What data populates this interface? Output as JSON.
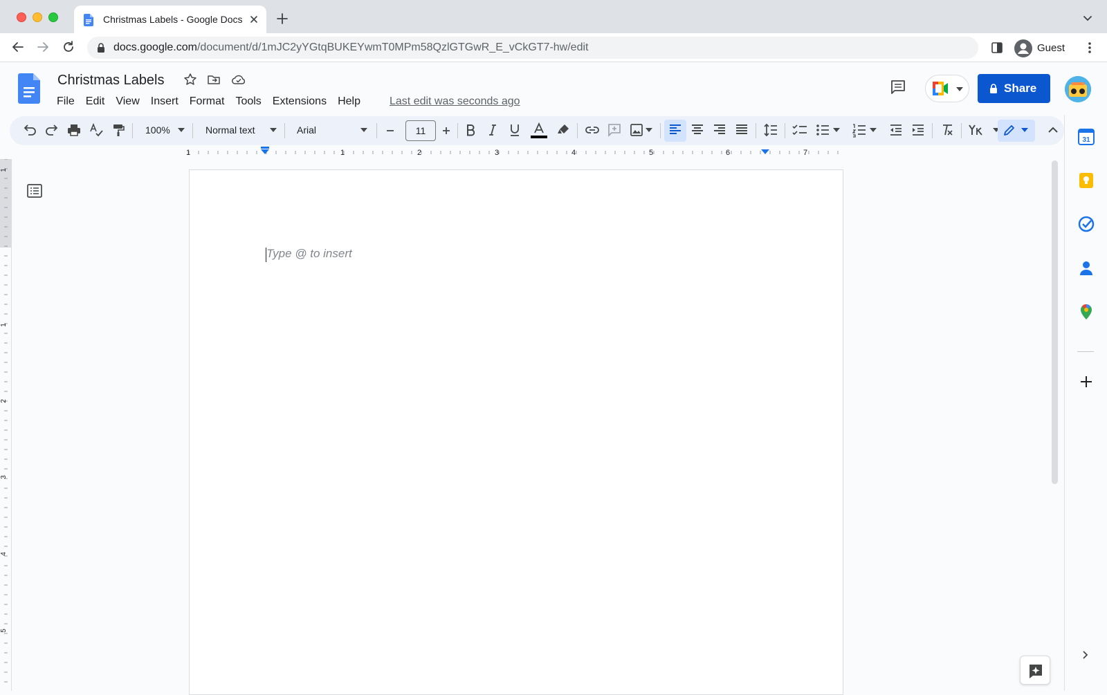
{
  "browser": {
    "tab_title": "Christmas Labels - Google Docs",
    "url_host": "docs.google.com",
    "url_path": "/document/d/1mJC2yYGtqBUKEYwmT0MPm58QzlGTGwR_E_vCkGT7-hw/edit",
    "profile_label": "Guest"
  },
  "doc": {
    "title": "Christmas Labels",
    "menus": [
      "File",
      "Edit",
      "View",
      "Insert",
      "Format",
      "Tools",
      "Extensions",
      "Help"
    ],
    "last_edit": "Last edit was seconds ago",
    "share_label": "Share"
  },
  "toolbar": {
    "zoom": "100%",
    "style": "Normal text",
    "font": "Arial",
    "font_size": "11",
    "text_color": "#000000",
    "active_color": "#d3e3fd"
  },
  "ruler": {
    "horizontal_labels": [
      "1",
      "1",
      "2",
      "3",
      "4",
      "5",
      "6",
      "7"
    ],
    "vertical_labels": [
      "1",
      "1",
      "2",
      "3",
      "4",
      "5"
    ]
  },
  "canvas": {
    "placeholder": "Type @ to insert"
  },
  "side_panel": {
    "calendar_day": "31"
  },
  "colors": {
    "accent": "#0b57d0",
    "docs_blue": "#4285f4"
  }
}
